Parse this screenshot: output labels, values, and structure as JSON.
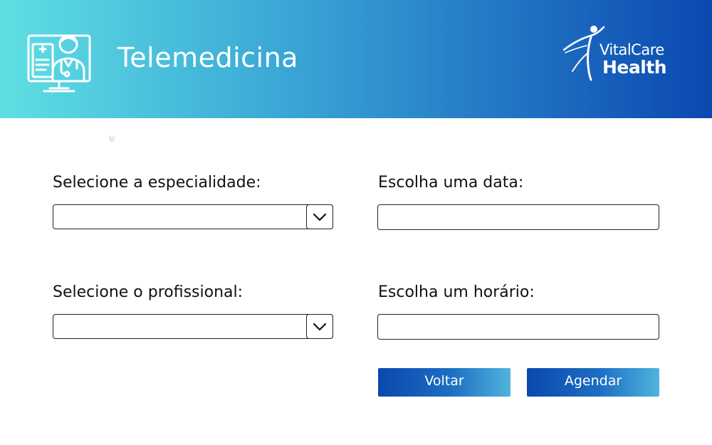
{
  "header": {
    "title": "Telemedicina",
    "icon": "doctor-monitor-icon",
    "logo": {
      "line1": "VitalCare",
      "line2": "Health"
    }
  },
  "form": {
    "specialty": {
      "label": "Selecione a especialidade:",
      "value": ""
    },
    "professional": {
      "label": "Selecione o profissional:",
      "value": ""
    },
    "date": {
      "label": "Escolha uma data:",
      "value": ""
    },
    "time": {
      "label": "Escolha um horário:",
      "value": ""
    }
  },
  "buttons": {
    "back": "Voltar",
    "schedule": "Agendar"
  },
  "colors": {
    "header_start": "#5fdfe3",
    "header_end": "#0b48b0",
    "button_start": "#0a48ae",
    "button_end": "#4fb4dd",
    "text": "#111111"
  }
}
